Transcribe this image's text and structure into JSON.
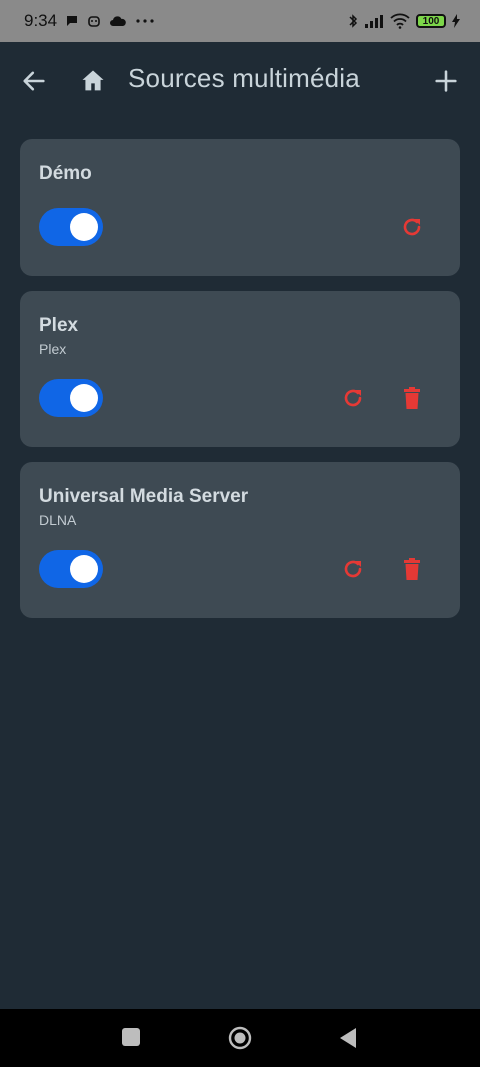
{
  "status_bar": {
    "time": "9:34",
    "battery": "100",
    "icons": [
      "chat-bubble-icon",
      "face-icon",
      "cloud-icon",
      "more-dots-icon",
      "bluetooth-icon",
      "signal-icon",
      "wifi-icon",
      "battery-icon",
      "charging-icon"
    ]
  },
  "app_bar": {
    "title": "Sources multimédia",
    "icons": [
      "back-arrow-icon",
      "home-icon",
      "add-icon"
    ]
  },
  "sources": [
    {
      "name": "Démo",
      "type": "",
      "enabled": true,
      "actions": [
        "refresh"
      ]
    },
    {
      "name": "Plex",
      "type": "Plex",
      "enabled": true,
      "actions": [
        "refresh",
        "delete"
      ]
    },
    {
      "name": "Universal Media Server",
      "type": "DLNA",
      "enabled": true,
      "actions": [
        "refresh",
        "delete"
      ]
    }
  ],
  "colors": {
    "background": "#1f2b35",
    "card": "#3e4a53",
    "accent_toggle": "#1066e6",
    "action_red": "#e53935",
    "status_bar": "#8a8a8a"
  },
  "nav_bar": {
    "icons": [
      "recents-square-icon",
      "home-circle-icon",
      "back-triangle-icon"
    ]
  }
}
